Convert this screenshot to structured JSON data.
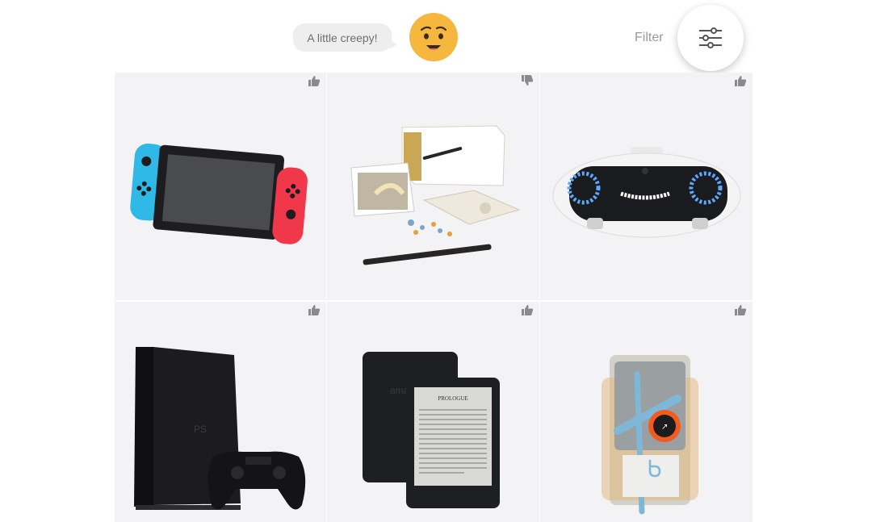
{
  "header": {
    "reaction_text": "A little creepy!",
    "emoji_icon": "smiling-face-icon",
    "filter_label": "Filter",
    "filter_icon": "sliders-icon"
  },
  "products": [
    {
      "name": "game-console-switch",
      "vote": "up"
    },
    {
      "name": "wand-coding-kit",
      "vote": "down"
    },
    {
      "name": "robot-companion",
      "vote": "up"
    },
    {
      "name": "game-console-playstation",
      "vote": "up"
    },
    {
      "name": "e-reader",
      "vote": "up"
    },
    {
      "name": "bike-navigator",
      "vote": "up"
    }
  ],
  "ereader_screen": {
    "title": "PROLOGUE"
  },
  "colors": {
    "tile_bg": "#f3f2f4",
    "vote_icon": "#8a8a8a",
    "emoji_face": "#f5b73e",
    "switch_blue": "#2fb9e6",
    "switch_red": "#f0384a",
    "robot_led": "#5aa8ff"
  }
}
